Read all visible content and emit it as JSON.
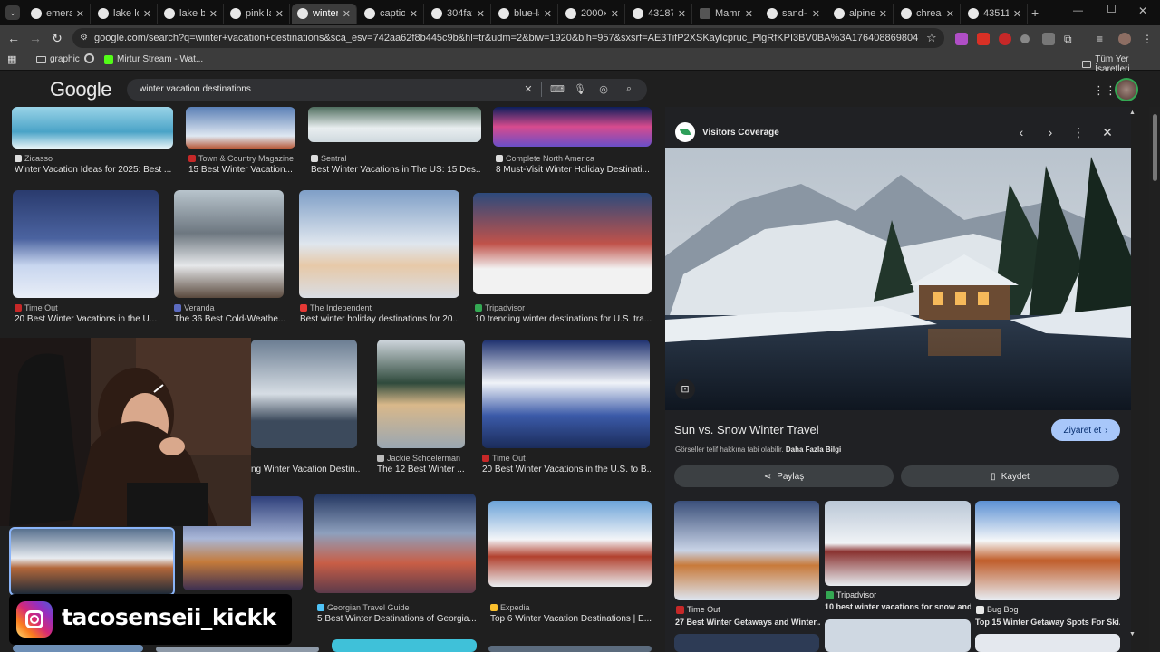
{
  "tabs": [
    {
      "title": "emeral",
      "active": false
    },
    {
      "title": "lake lou",
      "active": false
    },
    {
      "title": "lake blu",
      "active": false
    },
    {
      "title": "pink la",
      "active": false
    },
    {
      "title": "winter",
      "active": true
    },
    {
      "title": "caption",
      "active": false
    },
    {
      "title": "304faf",
      "active": false
    },
    {
      "title": "blue-la",
      "active": false
    },
    {
      "title": "2000x1",
      "active": false
    },
    {
      "title": "43187l",
      "active": false
    },
    {
      "title": "Mamm",
      "active": false
    },
    {
      "title": "sand-h",
      "active": false
    },
    {
      "title": "alpine",
      "active": false
    },
    {
      "title": "chrea n",
      "active": false
    },
    {
      "title": "435111",
      "active": false
    }
  ],
  "address": {
    "url": "google.com/search?q=winter+vacation+destinations&sca_esv=742aa62f8b445c9b&hl=tr&udm=2&biw=1920&bih=957&sxsrf=AE3TifP2XSKayIcpruc_PlgRfKPI3BV0BA%3A1764088698047&ei=etsIaYbRAsKJxc8PpdDYwA..."
  },
  "bookmarks": {
    "items": [
      "graphic",
      "Mirtur Stream - Wat..."
    ],
    "all": "Tüm Yer İşaretleri"
  },
  "google": {
    "logo": "Google",
    "query": "winter vacation destinations"
  },
  "results": {
    "row1": [
      {
        "source": "Zicasso",
        "caption": "Winter Vacation Ideas for 2025: Best ..."
      },
      {
        "source": "Town & Country Magazine",
        "caption": "15 Best Winter Vacation..."
      },
      {
        "source": "Sentral",
        "caption": "Best Winter Vacations in The US: 15 Des..."
      },
      {
        "source": "Complete North America",
        "caption": "8 Must-Visit Winter Holiday Destinati..."
      }
    ],
    "row2": [
      {
        "source": "Time Out",
        "caption": "20 Best Winter Vacations in the U..."
      },
      {
        "source": "Veranda",
        "caption": "The 36 Best Cold-Weathe..."
      },
      {
        "source": "The Independent",
        "caption": "Best winter holiday destinations for 20..."
      },
      {
        "source": "Tripadvisor",
        "caption": "10 trending winter destinations for U.S. tra..."
      }
    ],
    "row3": [
      {
        "source": "",
        "caption": "ng Winter Vacation Destin..."
      },
      {
        "source": "Jackie Schoelerman",
        "caption": "The 12 Best Winter ..."
      },
      {
        "source": "Time Out",
        "caption": "20 Best Winter Vacations in the U.S. to B..."
      }
    ],
    "row4": [
      {
        "source": "Georgian Travel Guide",
        "caption": "5 Best Winter Destinations of Georgia..."
      },
      {
        "source": "Expedia",
        "caption": "Top 6 Winter Vacation Destinations | E..."
      }
    ]
  },
  "panel": {
    "site": "Visitors Coverage",
    "title": "Sun vs. Snow Winter Travel",
    "visit": "Ziyaret et",
    "copyright": "Görseller telif hakkına tabi olabilir.",
    "more_info": "Daha Fazla Bilgi",
    "share": "Paylaş",
    "save": "Kaydet",
    "related": [
      {
        "source": "Time Out",
        "caption": "27 Best Winter Getaways and Winter..."
      },
      {
        "source": "Tripadvisor",
        "caption": "10 best winter vacations for snow and..."
      },
      {
        "source": "Bug Bog",
        "caption": "Top 15 Winter Getaway Spots For Ski..."
      }
    ]
  },
  "overlay": {
    "username": "tacosenseii_kickk"
  }
}
